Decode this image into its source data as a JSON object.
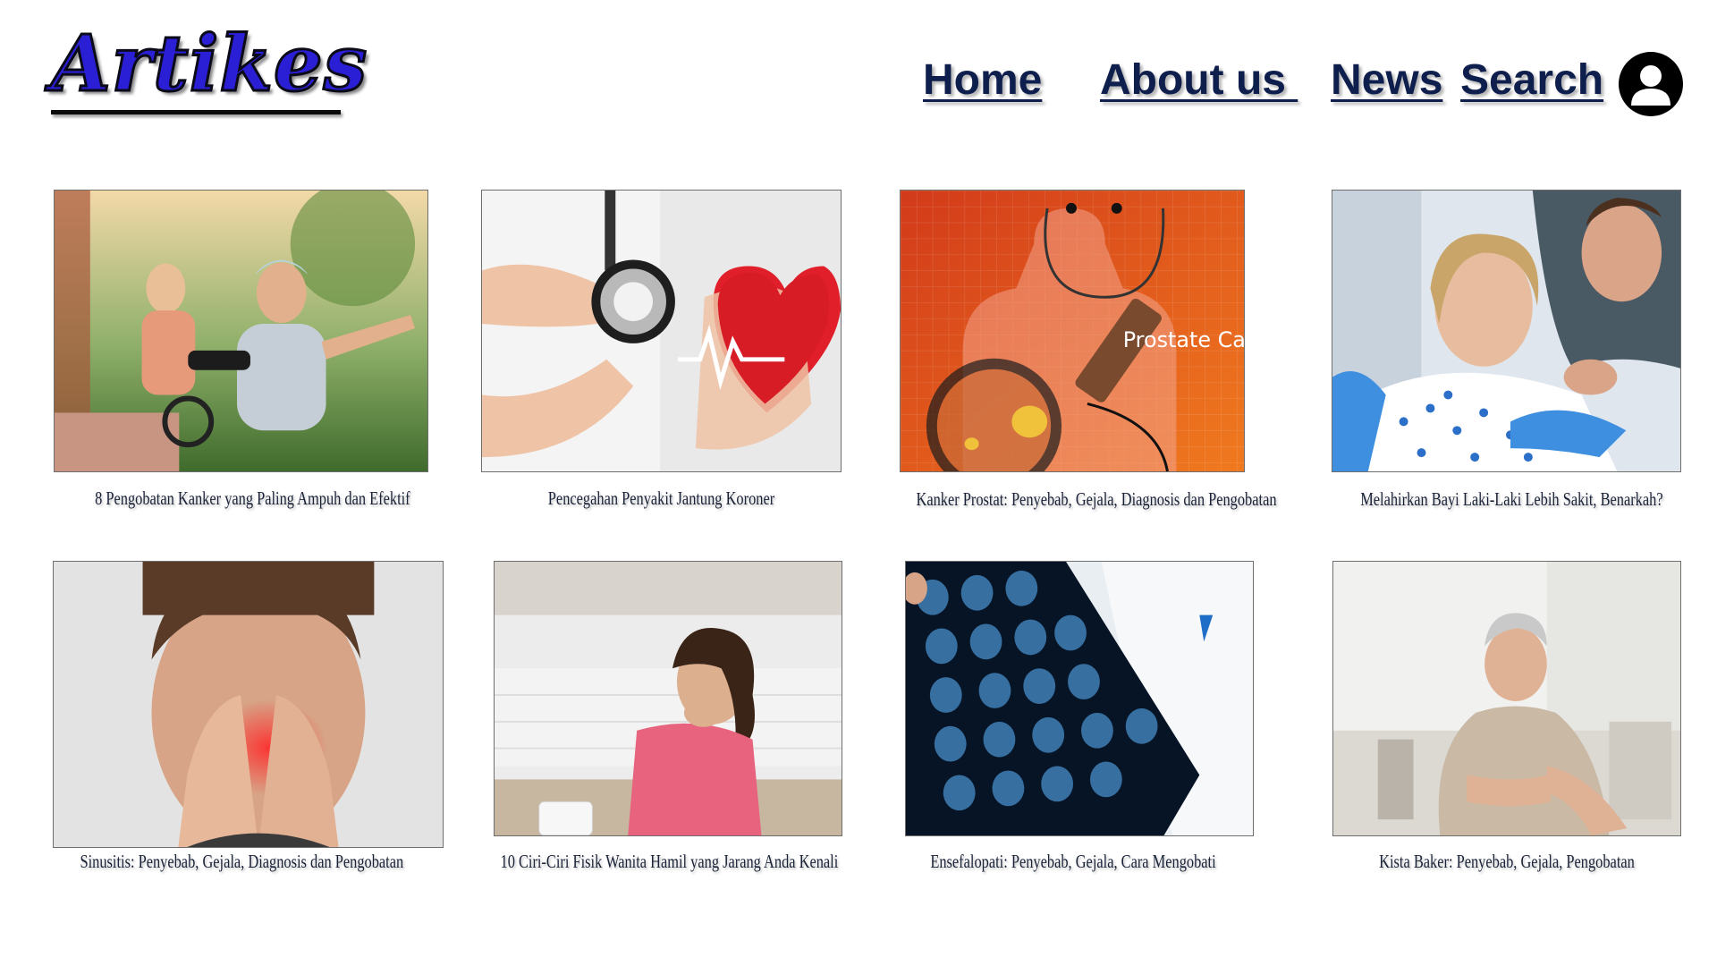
{
  "header": {
    "logo": "Artikes",
    "nav": {
      "home": "Home",
      "about": "About us ",
      "news": "News",
      "search": "Search"
    },
    "user_icon": "user-avatar-icon"
  },
  "colors": {
    "logo_fill": "#2b1fd6",
    "nav_text": "#0f1f4d",
    "caption_text": "#1a2238"
  },
  "articles": [
    {
      "title": "8 Pengobatan Kanker yang Paling Ampuh dan Efektif",
      "image": "cancer-patient-outdoors-photo"
    },
    {
      "title": "Pencegahan Penyakit Jantung Koroner",
      "image": "stethoscope-heart-photo"
    },
    {
      "title": "Kanker Prostat: Penyebab, Gejala, Diagnosis dan Pengobatan",
      "image": "prostate-cancer-illustration",
      "image_text": "Prostate Ca"
    },
    {
      "title": "Melahirkan Bayi Laki-Laki Lebih Sakit, Benarkah?",
      "image": "childbirth-photo"
    },
    {
      "title": "Sinusitis: Penyebab, Gejala, Diagnosis dan Pengobatan",
      "image": "sinus-pain-photo"
    },
    {
      "title": "10 Ciri-Ciri Fisik Wanita Hamil yang Jarang Anda Kenali",
      "image": "nauseous-woman-photo"
    },
    {
      "title": "Ensefalopati: Penyebab, Gejala, Cara Mengobati",
      "image": "brain-scan-photo"
    },
    {
      "title": "Kista Baker: Penyebab, Gejala, Pengobatan",
      "image": "knee-pain-photo"
    }
  ]
}
